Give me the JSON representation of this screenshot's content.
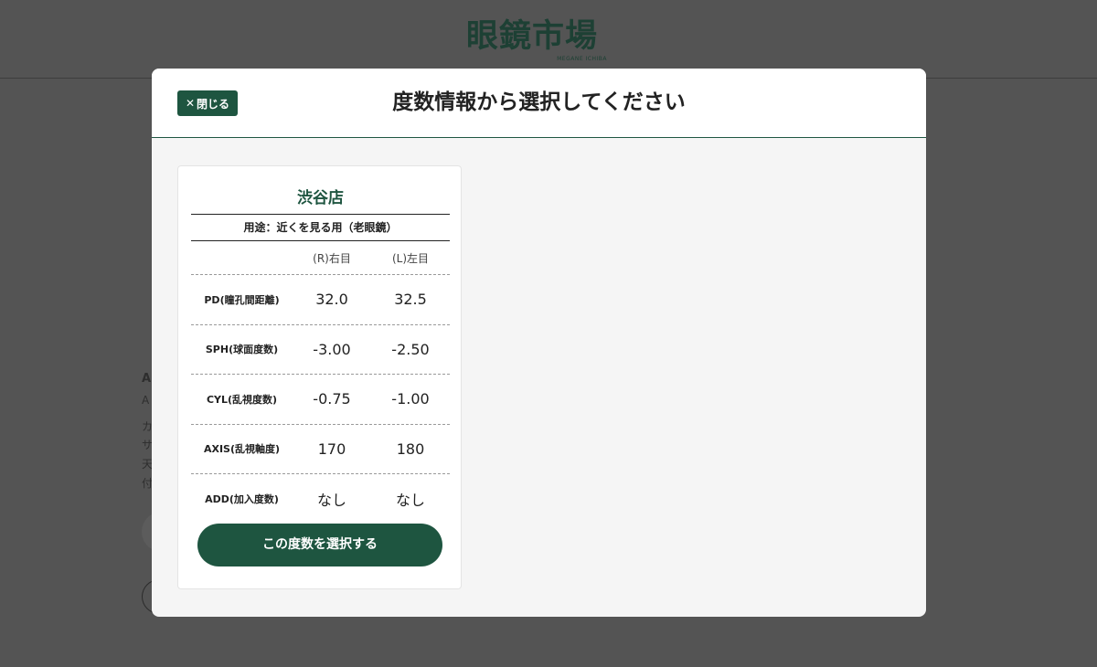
{
  "brand": {
    "logo_text": "眼鏡市場",
    "logo_sub": "MEGANE ICHIBA"
  },
  "background_fragments": [
    "A",
    "A",
    "カ",
    "サ",
    "天",
    "付"
  ],
  "modal": {
    "close_label": "閉じる",
    "title": "度数情報から選択してください"
  },
  "card": {
    "store_name": "渋谷店",
    "purpose": "用途：近くを見る用（老眼鏡）",
    "headers": {
      "right": "(R)右目",
      "left": "(L)左目"
    },
    "rows": [
      {
        "label": "PD(瞳孔間距離)",
        "right": "32.0",
        "left": "32.5"
      },
      {
        "label": "SPH(球面度数)",
        "right": "-3.00",
        "left": "-2.50"
      },
      {
        "label": "CYL(乱視度数)",
        "right": "-0.75",
        "left": "-1.00"
      },
      {
        "label": "AXIS(乱視軸度)",
        "right": "170",
        "left": "180"
      },
      {
        "label": "ADD(加入度数)",
        "right": "なし",
        "left": "なし"
      }
    ],
    "select_label": "この度数を選択する"
  },
  "colors": {
    "brand_green": "#1e5540",
    "overlay": "#545454"
  }
}
